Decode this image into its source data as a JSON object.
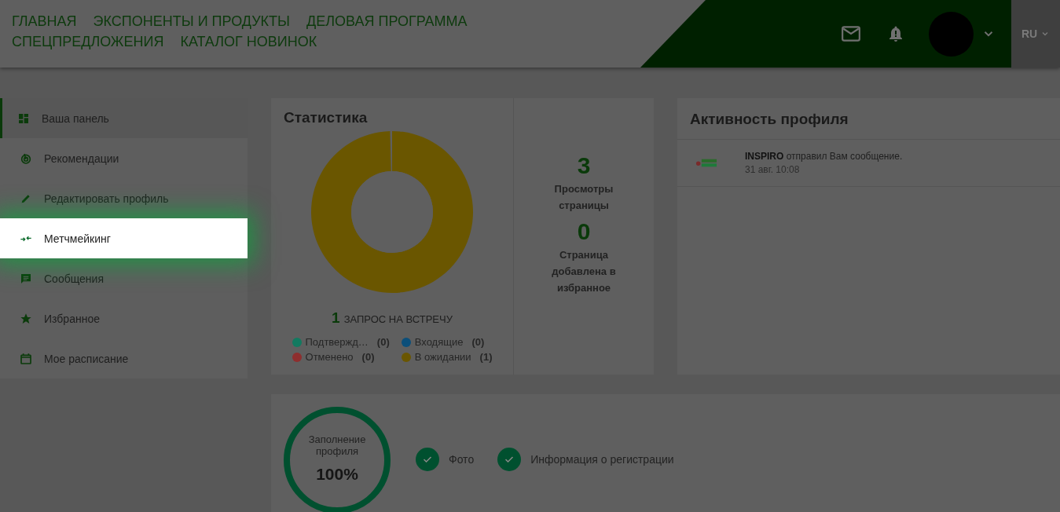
{
  "header": {
    "nav": [
      {
        "label": "ГЛАВНАЯ"
      },
      {
        "label": "ЭКСПОНЕНТЫ И ПРОДУКТЫ"
      },
      {
        "label": "ДЕЛОВАЯ ПРОГРАММА"
      },
      {
        "label": "СПЕЦПРЕДЛОЖЕНИЯ"
      },
      {
        "label": "КАТАЛОГ НОВИНОК"
      }
    ],
    "language": "RU"
  },
  "sidebar": {
    "items": [
      {
        "label": "Ваша панель",
        "selected": true,
        "spotlight": false
      },
      {
        "label": "Рекомендации",
        "selected": false,
        "spotlight": false
      },
      {
        "label": "Редактировать профиль",
        "selected": false,
        "spotlight": false
      },
      {
        "label": "Метчмейкинг",
        "selected": false,
        "spotlight": true
      },
      {
        "label": "Сообщения",
        "selected": false,
        "spotlight": false
      },
      {
        "label": "Избранное",
        "selected": false,
        "spotlight": false
      },
      {
        "label": "Мое расписание",
        "selected": false,
        "spotlight": false
      }
    ]
  },
  "statistics": {
    "title": "Статистика",
    "chart_data": {
      "type": "donut",
      "categories": [
        "Подтвержд…",
        "Входящие",
        "Отменено",
        "В ожидании"
      ],
      "values": [
        0,
        0,
        0,
        1
      ]
    },
    "request_count": "1",
    "request_label": "ЗАПРОС НА ВСТРЕЧУ",
    "legend": [
      {
        "count": "(0)",
        "color": "#127a60"
      },
      {
        "count": "(0)",
        "color": "#0c4f7a"
      },
      {
        "count": "(0)",
        "color": "#8e2e2e"
      },
      {
        "count": "(1)",
        "color": "#6a5600"
      }
    ],
    "metrics": [
      {
        "value": "3",
        "label": "Просмотры страницы"
      },
      {
        "value": "0",
        "label": "Страница добавлена в избранное"
      }
    ]
  },
  "activity": {
    "title": "Активность профиля",
    "items": [
      {
        "text": "**INSPIRO** отправил Вам сообщение.",
        "time": "31 авг. 10:08"
      }
    ]
  },
  "profile": {
    "ring_label": "Заполнение профиля",
    "ring_value": "100%",
    "level": 1,
    "checks": [
      {
        "label": "Фото",
        "checked": true
      },
      {
        "label": "Информация о регистрации",
        "checked": true
      }
    ]
  }
}
